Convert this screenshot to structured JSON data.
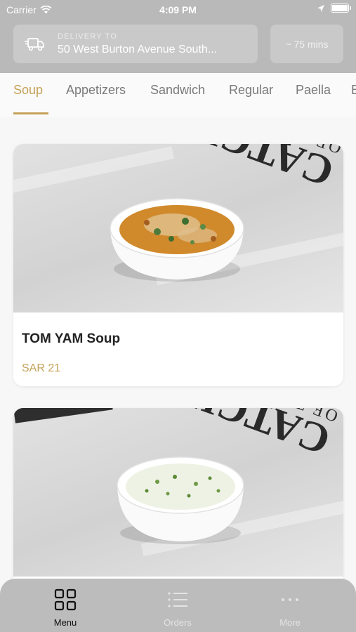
{
  "status_bar": {
    "carrier": "Carrier",
    "time": "4:09 PM"
  },
  "delivery": {
    "label": "DELIVERY TO",
    "address": "50 West Burton Avenue South...",
    "eta": "~ 75 mins"
  },
  "tabs": [
    {
      "label": "Soup",
      "active": true
    },
    {
      "label": "Appetizers"
    },
    {
      "label": "Sandwich"
    },
    {
      "label": "Regular"
    },
    {
      "label": "Paella"
    },
    {
      "label": "B"
    }
  ],
  "items": [
    {
      "name": "TOM YAM Soup",
      "price": "SAR 21",
      "photo_text": [
        "CATCH",
        "OF THE DAY"
      ]
    },
    {
      "name": "",
      "price": "",
      "photo_text": [
        "CATCH",
        "OF THE DAY"
      ]
    }
  ],
  "bottom_nav": [
    {
      "label": "Menu",
      "icon": "grid-icon",
      "active": true
    },
    {
      "label": "Orders",
      "icon": "list-icon"
    },
    {
      "label": "More",
      "icon": "more-icon"
    }
  ],
  "colors": {
    "accent": "#c5a258",
    "header_bg": "#b9b9b9",
    "nav_bg": "#bcbcbc"
  }
}
